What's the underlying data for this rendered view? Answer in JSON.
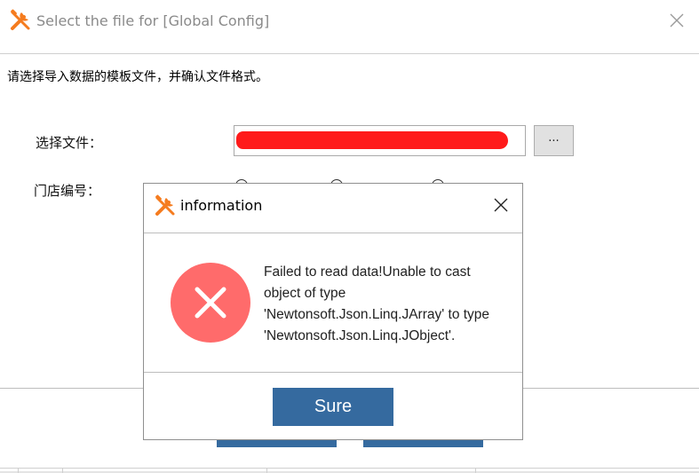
{
  "main_window": {
    "title": "Select the file for [Global Config]",
    "instructions": "请选择导入数据的模板文件，并确认文件格式。",
    "select_file_label": "选择文件：",
    "browse_label": "...",
    "store_number_label": "门店编号：",
    "file_path_redaction_color": "#ff1a1a"
  },
  "dialog": {
    "title": "information",
    "message": "Failed to read data!Unable to cast\nobject of type\n'Newtonsoft.Json.Linq.JArray' to type\n'Newtonsoft.Json.Linq.JObject'.",
    "ok_label": "Sure",
    "icon": "error-icon",
    "error_color": "#ff6b6b",
    "button_color": "#356a9f"
  },
  "icons": {
    "app": "tools-icon",
    "close": "close-icon"
  },
  "accent": "#f57c1f"
}
